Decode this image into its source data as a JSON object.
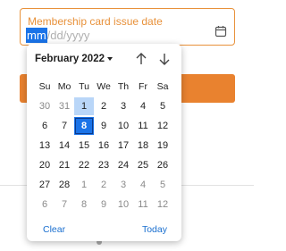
{
  "field": {
    "label": "Membership card issue date",
    "segments": {
      "month": "mm",
      "sep1": "/",
      "day": "dd",
      "sep2": "/",
      "year": "yyyy"
    },
    "icon": "calendar-icon",
    "accent_color": "#e8913a"
  },
  "calendar": {
    "month_label": "February 2022",
    "nav_up_icon": "arrow-up-icon",
    "nav_down_icon": "arrow-down-icon",
    "weekdays": [
      "Su",
      "Mo",
      "Tu",
      "We",
      "Th",
      "Fr",
      "Sa"
    ],
    "weeks": [
      [
        "30",
        "31",
        "1",
        "2",
        "3",
        "4",
        "5"
      ],
      [
        "6",
        "7",
        "8",
        "9",
        "10",
        "11",
        "12"
      ],
      [
        "13",
        "14",
        "15",
        "16",
        "17",
        "18",
        "19"
      ],
      [
        "20",
        "21",
        "22",
        "23",
        "24",
        "25",
        "26"
      ],
      [
        "27",
        "28",
        "1",
        "2",
        "3",
        "4",
        "5"
      ],
      [
        "6",
        "7",
        "8",
        "9",
        "10",
        "11",
        "12"
      ]
    ],
    "today_day": "1",
    "selected_day": "8",
    "clear_label": "Clear",
    "today_label": "Today",
    "selected_color": "#1a73e8"
  },
  "submit_button": {
    "color": "#e9822f"
  }
}
